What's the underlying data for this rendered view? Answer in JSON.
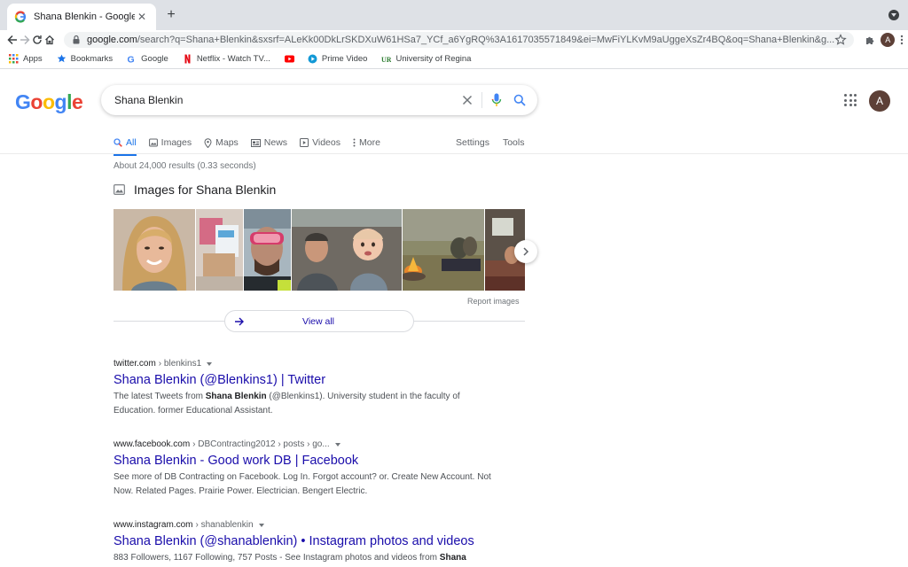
{
  "browser": {
    "tab_title": "Shana Blenkin - Google Search",
    "new_tab": "+",
    "close_tab": "✕",
    "url_host": "google.com",
    "url_rest": "/search?q=Shana+Blenkin&sxsrf=ALeKk00DkLrSKDXuW61HSa7_YCf_a6YgRQ%3A1617035571849&ei=MwFiYLKvM9aUggeXsZr4BQ&oq=Shana+Blenkin&g...",
    "profile_initial": "A",
    "bookmarks": [
      {
        "label": "Apps"
      },
      {
        "label": "Bookmarks"
      },
      {
        "label": "Google"
      },
      {
        "label": "Netflix - Watch TV..."
      },
      {
        "label": ""
      },
      {
        "label": "Prime Video"
      },
      {
        "label": "University of Regina"
      }
    ]
  },
  "google": {
    "logo_letters": [
      "G",
      "o",
      "o",
      "g",
      "l",
      "e"
    ],
    "query": "Shana Blenkin",
    "avatar_initial": "A",
    "tabs": [
      {
        "label": "All"
      },
      {
        "label": "Images"
      },
      {
        "label": "Maps"
      },
      {
        "label": "News"
      },
      {
        "label": "Videos"
      },
      {
        "label": "More"
      }
    ],
    "tools": {
      "settings": "Settings",
      "tools": "Tools"
    },
    "stats": "About 24,000 results (0.33 seconds)",
    "images_heading": "Images for Shana Blenkin",
    "report_images": "Report images",
    "view_all": "View all"
  },
  "results": [
    {
      "domain": "twitter.com",
      "crumb": "› blenkins1",
      "title": "Shana Blenkin (@Blenkins1) | Twitter",
      "snippet_pre": "The latest Tweets from ",
      "snippet_bold": "Shana Blenkin",
      "snippet_post": " (@Blenkins1). University student in the faculty of Education. former Educational Assistant."
    },
    {
      "domain": "www.facebook.com",
      "crumb": "› DBContracting2012 › posts › go...",
      "title": "Shana Blenkin - Good work DB | Facebook",
      "snippet_pre": "See more of DB Contracting on Facebook. Log In. Forgot account? or. Create New Account. Not Now. Related Pages. Prairie Power. Electrician. Bengert Electric.",
      "snippet_bold": "",
      "snippet_post": ""
    },
    {
      "domain": "www.instagram.com",
      "crumb": "› shanablenkin",
      "title": "Shana Blenkin (@shanablenkin) • Instagram photos and videos",
      "snippet_pre": "883 Followers, 1167 Following, 757 Posts - See Instagram photos and videos from ",
      "snippet_bold": "Shana",
      "snippet_post": ""
    }
  ],
  "colors": {
    "link": "#1a0dab",
    "accent_blue": "#1a73e8",
    "google_blue": "#4285f4",
    "google_red": "#ea4335",
    "google_yellow": "#fbbc05",
    "google_green": "#34a853"
  }
}
